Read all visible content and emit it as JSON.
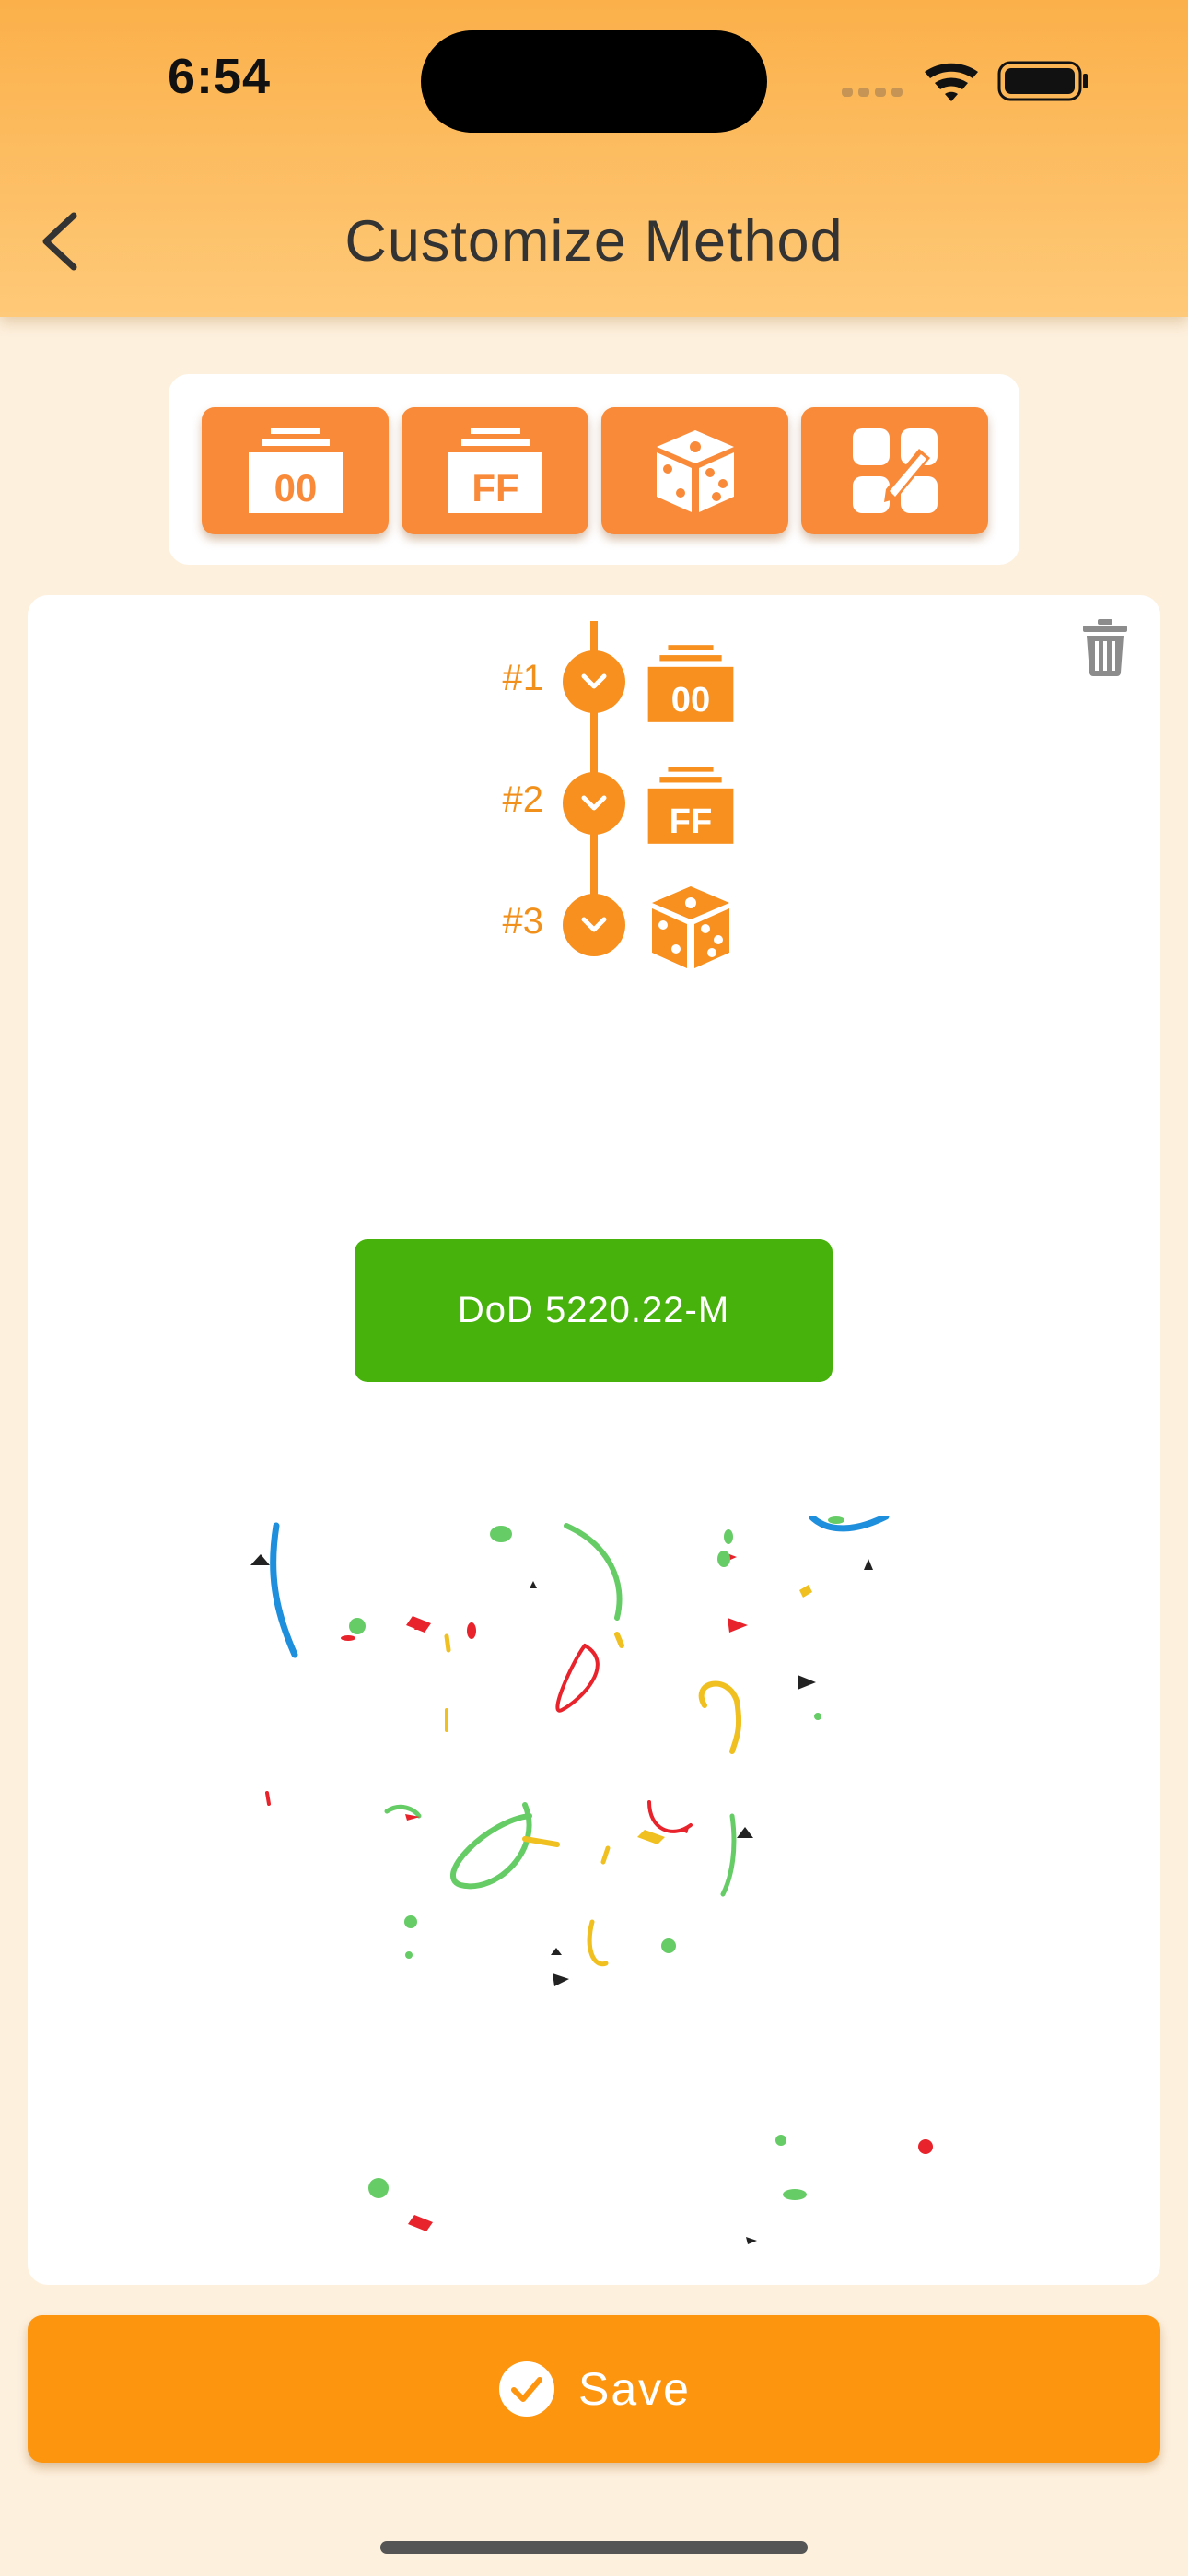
{
  "status_bar": {
    "time": "6:54"
  },
  "header": {
    "title": "Customize Method"
  },
  "toolbar": {
    "tools": [
      {
        "icon": "zero-fill-icon",
        "label": "00"
      },
      {
        "icon": "ff-fill-icon",
        "label": "FF"
      },
      {
        "icon": "dice-random-icon"
      },
      {
        "icon": "custom-pattern-icon"
      }
    ]
  },
  "steps": [
    {
      "number": "#1",
      "icon": "zero-fill-icon",
      "label": "00"
    },
    {
      "number": "#2",
      "icon": "ff-fill-icon",
      "label": "FF"
    },
    {
      "number": "#3",
      "icon": "dice-random-icon"
    }
  ],
  "method": {
    "name": "DoD 5220.22-M"
  },
  "footer": {
    "save_label": "Save"
  },
  "colors": {
    "header_top": "#fbb04a",
    "accent_orange": "#f98a3a",
    "step_orange": "#f7901e",
    "method_green": "#47b20b",
    "save_orange": "#fd950f",
    "background": "#fdf0dd"
  }
}
